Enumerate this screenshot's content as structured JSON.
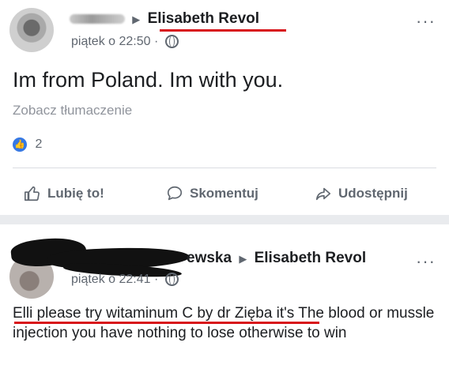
{
  "post1": {
    "target_name": "Elisabeth Revol",
    "timestamp": "piątek o 22:50",
    "separator": "·",
    "message": "Im from Poland. Im with you.",
    "translate_link": "Zobacz tłumaczenie",
    "like_count": "2",
    "actions": {
      "like": "Lubię to!",
      "comment": "Skomentuj",
      "share": "Udostępnij"
    }
  },
  "post2": {
    "author_visible_suffix": "ewska",
    "target_name": "Elisabeth Revol",
    "timestamp": "piątek o 22:41",
    "separator": "·",
    "message": "Elli please try witaminum C by dr Zięba it's The blood or mussle injection you have nothing to lose otherwise to win"
  },
  "menu_glyph": "···",
  "arrow_glyph": "▶",
  "colors": {
    "like_blue": "#3578e5",
    "redline": "#d8141b",
    "meta_gray": "#606770"
  },
  "icons": [
    "globe-icon",
    "thumbs-up-icon",
    "comment-bubble-icon",
    "share-arrow-icon",
    "more-options-icon"
  ]
}
